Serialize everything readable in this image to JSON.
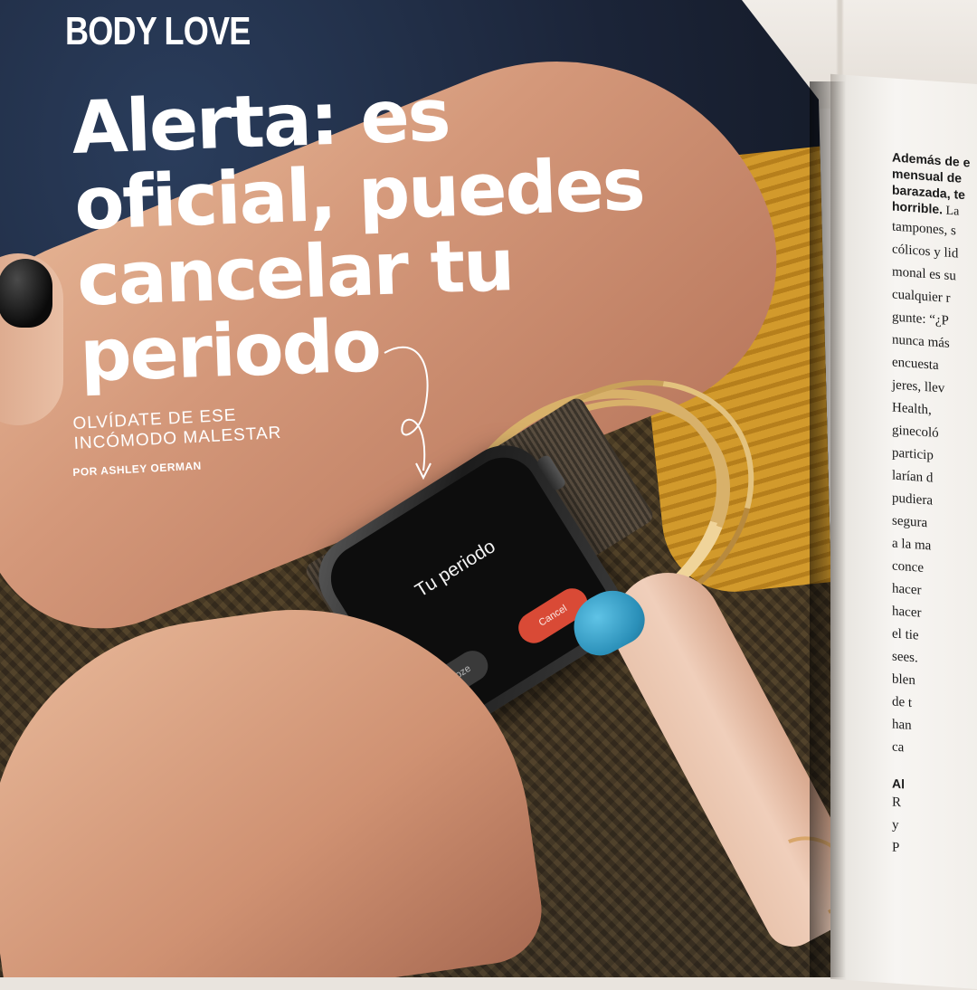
{
  "magazine": {
    "section_label": "BODY LOVE",
    "headline_lines": [
      "Alerta: es",
      "oficial, puedes",
      "cancelar tu",
      "periodo"
    ],
    "subhead_lines": [
      "OLVÍDATE DE ESE",
      "INCÓMODO MALESTAR"
    ],
    "byline": "POR ASHLEY OERMAN"
  },
  "watch": {
    "title": "Tu periodo",
    "snooze_label": "Snooze",
    "cancel_label": "Cancel"
  },
  "right_page": {
    "lead_lines": [
      "Además de e",
      "mensual de",
      "barazada, te",
      "horrible."
    ],
    "lead_tail": " La",
    "body_lines": [
      "tampones, s",
      "cólicos y lid",
      "monal es su",
      "cualquier r",
      "gunte: “¿P",
      "nunca más",
      "encuesta",
      "jeres, llev",
      "Health,",
      "ginecoló",
      "particip",
      "larían d",
      "pudiera",
      "segura",
      "a la ma",
      "conce",
      "hacer",
      "hacer",
      "el tie",
      "sees.",
      "blen",
      "de t",
      "han",
      "ca"
    ],
    "section_label": "Al",
    "tail_lines": [
      "R",
      "y",
      "P"
    ]
  },
  "colors": {
    "nail_blue": "#2a8fb8",
    "nail_black": "#0a0a0a",
    "cancel_red": "#d94a36",
    "sweater_mustard": "#d29a2c"
  }
}
